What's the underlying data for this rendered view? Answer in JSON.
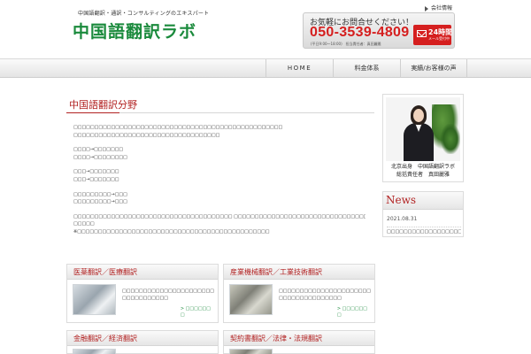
{
  "header": {
    "logo_tagline": "中国語翻訳・通訳・コンサルティングのエキスパート",
    "logo_name": "中国語翻訳ラボ",
    "company_link": "会社情報",
    "contact": {
      "heading": "お気軽にお問合せください！",
      "phone": "050-3539-4809",
      "hours": "(平日9:00～18:00)　担当責任者：真田麗雅",
      "mail_main": "24時間",
      "mail_sub": "メール受付中"
    }
  },
  "nav": {
    "items": [
      {
        "label": "HOME"
      },
      {
        "label": "料金体系"
      },
      {
        "label": "実績/お客様の声"
      }
    ]
  },
  "main": {
    "title": "中国語翻訳分野",
    "paragraphs": [
      "□□□□□□□□□□□□□□□□□□□□□□□□□□□□□□□□□□□□□□□□□□□□□□□□□□",
      "□□□□□□□□□□□□□□□□□□□□□□□□□□□□□□□□□□□",
      "",
      "□□□□→□□□□□□□",
      "□□□□→□□□□□□□□",
      "",
      "□□□→□□□□□□□",
      "□□□→□□□□□□□",
      "",
      "□□□□□□□□□→□□□",
      "□□□□□□□□□→□□□",
      "",
      "□□□□□□□□□□□□□□□□□□□□□□□□□□□□□□□□□□□□□□ □□□□□□□□□□□□□□□□□□□□□□□□□□□□□□□□□□□□□□□□DTP□□□",
      "□□□□□",
      "※□□□□□□□□□□□□□□□□□□□□□□□□□□□□□□□□□□□□□□□□□□□□□□"
    ]
  },
  "services": [
    {
      "title": "医薬翻訳／医療翻訳",
      "desc": "□□□□□□□□□□□□□□□□□□□□□□□□□□□□□□□□□",
      "more": "> □□□□□□\n□"
    },
    {
      "title": "産業機械翻訳／工業技術翻訳",
      "desc": "□□□□□□□□□□□□□□□□□□□□□□□□□□□□□□□□□□□□□",
      "more": "> □□□□□□\n□"
    },
    {
      "title": "金融翻訳／経済翻訳",
      "desc": "",
      "more": ""
    },
    {
      "title": "契約書翻訳／法律・法規翻訳",
      "desc": "",
      "more": ""
    }
  ],
  "sidebar": {
    "profile_caption_1": "北京出身　中国語翻訳ラボ",
    "profile_caption_2": "総括責任者　真田麗雅",
    "news": {
      "heading": "News",
      "date": "2021.08.31",
      "entry": "□□□□□□□□□□□□□□□□□□□□"
    }
  }
}
